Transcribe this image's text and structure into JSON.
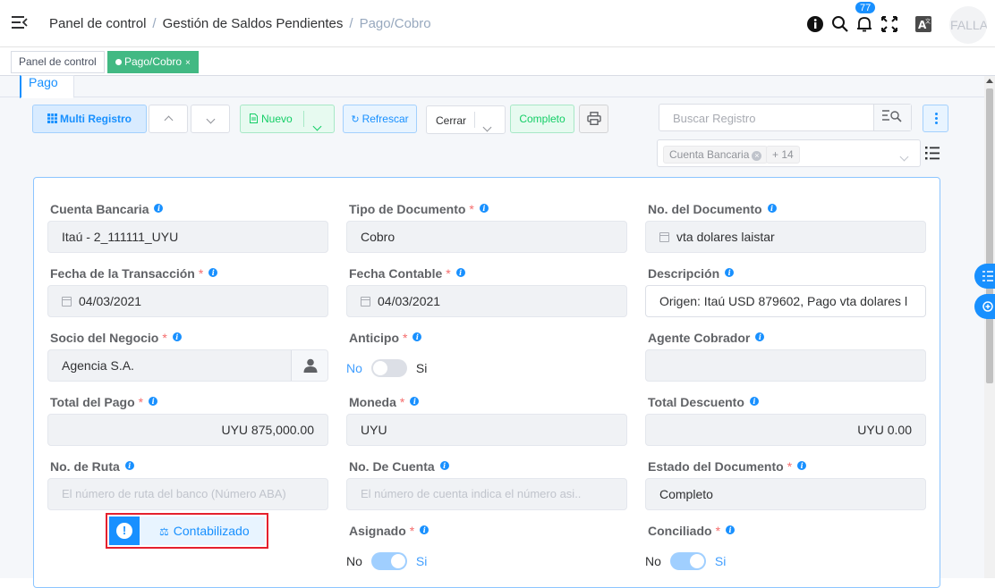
{
  "header": {
    "breadcrumbs": [
      "Panel de control",
      "Gestión de Saldos Pendientes",
      "Pago/Cobro"
    ],
    "notification_count": "77",
    "avatar_text": "FALLA",
    "icons": [
      "menu-fold-icon",
      "info-icon",
      "search-icon",
      "bell-icon",
      "fullscreen-icon",
      "translate-icon"
    ]
  },
  "tags": {
    "home": "Panel de control",
    "active": "Pago/Cobro",
    "active_close": "×"
  },
  "tab": {
    "label": "Pago"
  },
  "toolbar": {
    "multi_label": "Multi Registro",
    "new_label": "Nuevo",
    "refresh_label": "Refrescar",
    "close_label": "Cerrar",
    "complete_label": "Completo",
    "search_placeholder": "Buscar Registro",
    "filter_chip": "Cuenta Bancaria",
    "filter_more": "+ 14"
  },
  "form": {
    "cuenta_bancaria": {
      "label": "Cuenta Bancaria",
      "value": "Itaú - 2_111111_UYU"
    },
    "tipo_documento": {
      "label": "Tipo de Documento",
      "value": "Cobro"
    },
    "no_documento": {
      "label": "No. del Documento",
      "value": "vta dolares laistar"
    },
    "fecha_transaccion": {
      "label": "Fecha de la Transacción",
      "value": "04/03/2021"
    },
    "fecha_contable": {
      "label": "Fecha Contable",
      "value": "04/03/2021"
    },
    "descripcion": {
      "label": "Descripción",
      "value": "Origen: Itaú USD 879602, Pago vta dolares l"
    },
    "socio": {
      "label": "Socio del Negocio",
      "value": "Agencia S.A."
    },
    "anticipo": {
      "label": "Anticipo",
      "off": "No",
      "on": "Si",
      "checked": false
    },
    "agente": {
      "label": "Agente Cobrador",
      "value": ""
    },
    "total_pago": {
      "label": "Total del Pago",
      "value": "UYU 875,000.00"
    },
    "moneda": {
      "label": "Moneda",
      "value": "UYU"
    },
    "total_descuento": {
      "label": "Total Descuento",
      "value": "UYU 0.00"
    },
    "no_ruta": {
      "label": "No. de Ruta",
      "placeholder": "El número de ruta del banco (Número ABA)"
    },
    "no_cuenta": {
      "label": "No. De Cuenta",
      "placeholder": "El número de cuenta indica el número asi.."
    },
    "estado": {
      "label": "Estado del Documento",
      "value": "Completo"
    },
    "contabilizado": "Contabilizado",
    "contab_icon": "!",
    "asignado": {
      "label": "Asignado",
      "off": "No",
      "on": "Si",
      "checked": true
    },
    "conciliado": {
      "label": "Conciliado",
      "off": "No",
      "on": "Si",
      "checked": true
    }
  },
  "required_mark": "*",
  "info_mark": "i"
}
